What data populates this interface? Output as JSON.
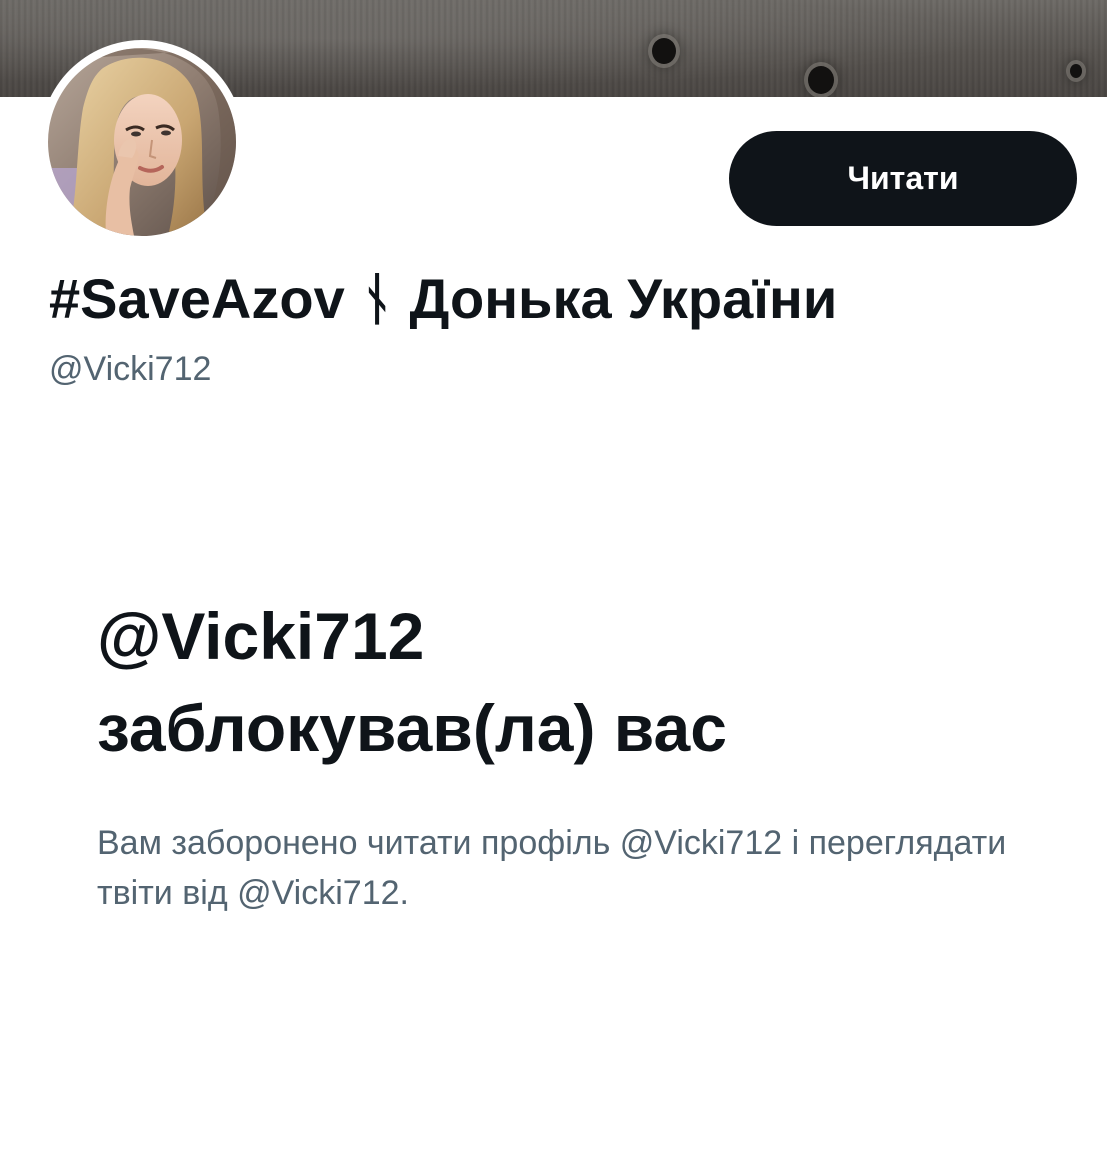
{
  "profile": {
    "display_name": "#SaveAzov ᚾ Донька України",
    "handle": "@Vicki712",
    "follow_button_label": "Читати",
    "avatar_icon": "profile-photo"
  },
  "blocked_notice": {
    "title_line1": "@Vicki712",
    "title_line2": "заблокував(ла) вас",
    "description": "Вам заборонено читати профіль @Vicki712 і переглядати твіти від @Vicki712."
  },
  "colors": {
    "primary_text": "#0f1419",
    "secondary_text": "#536471",
    "button_bg": "#0f1419",
    "button_text": "#ffffff",
    "background": "#ffffff"
  }
}
